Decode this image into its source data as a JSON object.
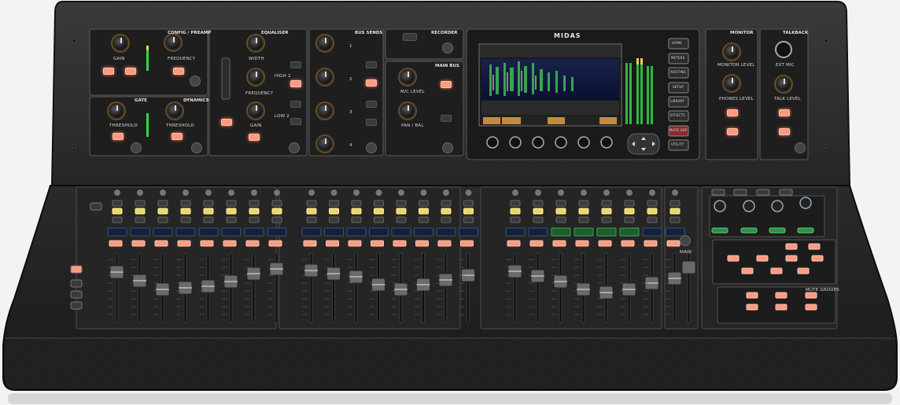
{
  "brand": {
    "logo_text": "MIDAS"
  },
  "sections": {
    "config": "CONFIG / PREAMP",
    "equaliser": "EQUALISER",
    "bus_sends": "BUS SENDS",
    "recorder": "RECORDER",
    "main_bus": "MAIN BUS",
    "gate": "GATE",
    "dynamics": "DYNAMICS",
    "monitor": "MONITOR",
    "talkback": "TALKBACK"
  },
  "labels": {
    "gain": "GAIN",
    "frequency": "FREQUENCY",
    "threshold_gate": "THRESHOLD",
    "threshold_dyn": "THRESHOLD",
    "width": "WIDTH",
    "eq_frequency": "FREQUENCY",
    "eq_gain": "GAIN",
    "high2": "HIGH 2",
    "low2": "LOW 2",
    "mlc_level": "M/C LEVEL",
    "pan_bal": "PAN / BAL",
    "monitor_level": "MONITOR LEVEL",
    "phones_level": "PHONES LEVEL",
    "ext_mic": "EXT MIC",
    "talk_level": "TALK LEVEL",
    "mute_groups": "MUTE GROUPS",
    "main": "MAIN"
  },
  "bus_send_numbers": [
    "1",
    "2",
    "3",
    "4"
  ],
  "screen_buttons": [
    "HOME",
    "METERS",
    "ROUTING",
    "SETUP",
    "LIBRARY",
    "EFFECTS",
    "MUTE GRP",
    "UTILITY"
  ],
  "colors": {
    "console_top": "#2e2e2e",
    "panel": "#1e1e1e",
    "panel_line": "#5a5a5a",
    "accent_orange": "#ff9a80",
    "knob_ring": "#ff9c2a",
    "meter_green": "#36d24a",
    "meter_yellow": "#e8d24a",
    "screen_spectrum": "#3fb05a"
  }
}
